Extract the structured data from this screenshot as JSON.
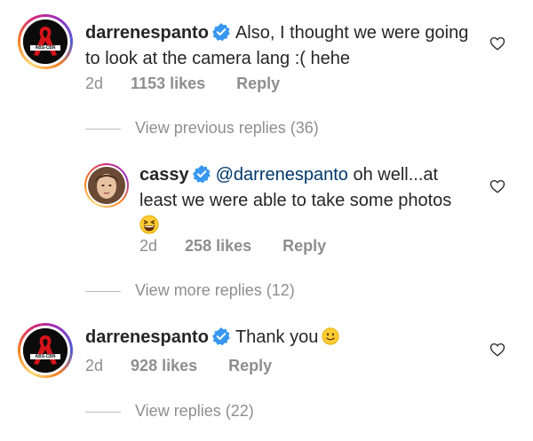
{
  "comments": [
    {
      "username": "darrenespanto",
      "text_line1": "Also, I thought we were going",
      "text_line2": "to look at the camera lang :( hehe",
      "time": "2d",
      "likes": "1153 likes",
      "reply": "Reply",
      "avatar_text": "ABS-CBN"
    },
    {
      "username": "cassy",
      "mention": "@darrenespanto",
      "text_after_mention": " oh well...at",
      "text_line2": "least we were able to take some photos",
      "emoji": "grinning-squinting-face",
      "time": "2d",
      "likes": "258 likes",
      "reply": "Reply"
    },
    {
      "username": "darrenespanto",
      "text": "Thank you",
      "emoji": "smiling-face",
      "time": "2d",
      "likes": "928 likes",
      "reply": "Reply",
      "avatar_text": "ABS-CBN"
    }
  ],
  "view_previous_replies": "View previous replies (36)",
  "view_more_replies": "View more replies (12)",
  "view_replies": "View replies (22)",
  "colors": {
    "text": "#262626",
    "secondary": "#8e8e8e",
    "verified": "#3897f0",
    "mention": "#00376b"
  }
}
